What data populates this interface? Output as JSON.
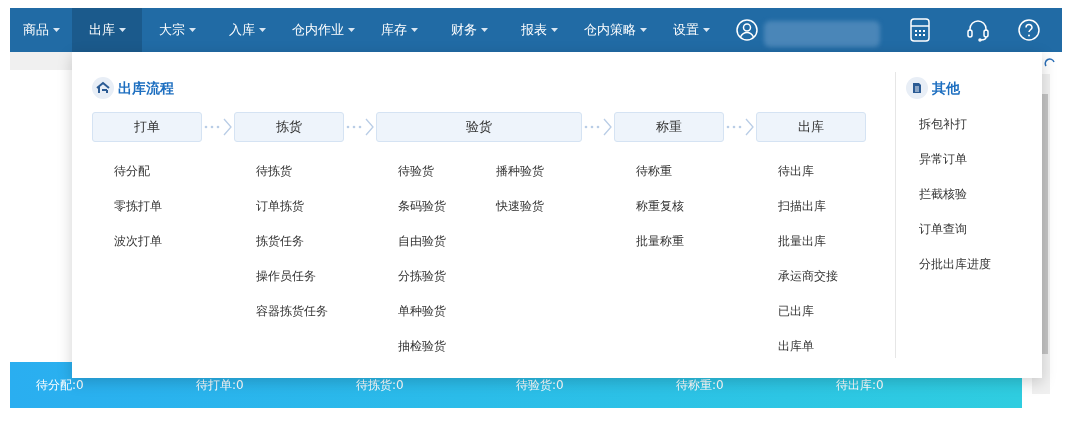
{
  "nav": {
    "menus": [
      {
        "label": "商品",
        "selected": false
      },
      {
        "label": "出库",
        "selected": true
      },
      {
        "label": "大宗",
        "selected": false
      },
      {
        "label": "入库",
        "selected": false
      },
      {
        "label": "仓内作业",
        "selected": false
      },
      {
        "label": "库存",
        "selected": false
      },
      {
        "label": "财务",
        "selected": false
      },
      {
        "label": "报表",
        "selected": false
      },
      {
        "label": "仓内策略",
        "selected": false
      },
      {
        "label": "设置",
        "selected": false
      }
    ]
  },
  "outbound_menu": {
    "title": "出库流程",
    "stages": [
      {
        "label": "打单",
        "columns": [
          [
            "待分配",
            "零拣打单",
            "波次打单"
          ]
        ]
      },
      {
        "label": "拣货",
        "columns": [
          [
            "待拣货",
            "订单拣货",
            "拣货任务",
            "操作员任务",
            "容器拣货任务"
          ]
        ]
      },
      {
        "label": "验货",
        "columns": [
          [
            "待验货",
            "条码验货",
            "自由验货",
            "分拣验货",
            "单种验货",
            "抽检验货"
          ],
          [
            "播种验货",
            "快速验货"
          ]
        ]
      },
      {
        "label": "称重",
        "columns": [
          [
            "待称重",
            "称重复核",
            "批量称重"
          ]
        ]
      },
      {
        "label": "出库",
        "columns": [
          [
            "待出库",
            "扫描出库",
            "批量出库",
            "承运商交接",
            "已出库",
            "出库单"
          ]
        ]
      }
    ]
  },
  "other_menu": {
    "title": "其他",
    "items": [
      "拆包补打",
      "异常订单",
      "拦截核验",
      "订单查询",
      "分批出库进度"
    ]
  },
  "status_bar": {
    "items": [
      "待分配:0",
      "待打单:0",
      "待拣货:0",
      "待验货:0",
      "待称重:0",
      "待出库:0"
    ]
  }
}
